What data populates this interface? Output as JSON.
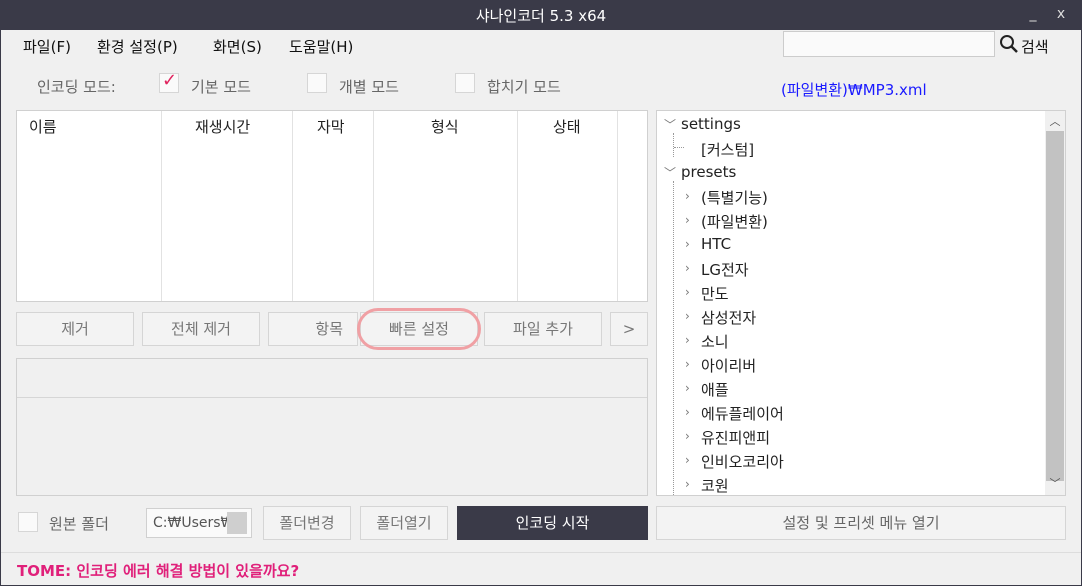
{
  "titlebar": {
    "title": "샤나인코더  5.3  x64",
    "minimize": "_",
    "close": "x"
  },
  "menu": {
    "items": [
      "파일(F)",
      "환경 설정(P)",
      "화면(S)",
      "도움말(H)"
    ],
    "search_value": "",
    "search_label": "검색"
  },
  "encoding_mode": {
    "label": "인코딩 모드:",
    "options": [
      {
        "label": "기본 모드",
        "checked": true
      },
      {
        "label": "개별 모드",
        "checked": false
      },
      {
        "label": "합치기 모드",
        "checked": false
      }
    ],
    "preset_path": "(파일변환)₩MP3.xml",
    "accent_color": "#1a1aff"
  },
  "file_table": {
    "columns": [
      "이름",
      "재생시간",
      "자막",
      "형식",
      "상태"
    ]
  },
  "buttons": {
    "remove": "제거",
    "remove_all": "전체 제거",
    "items": "항목",
    "quick_settings": "빠른 설정",
    "add_file": "파일 추가",
    "more": ">"
  },
  "tree": {
    "nodes": [
      {
        "label": "settings",
        "icon": "chevron-down-icon"
      },
      {
        "label": "[커스텀]"
      },
      {
        "label": "presets",
        "icon": "chevron-down-icon"
      },
      {
        "label": "(특별기능)",
        "icon": "chevron-right-icon"
      },
      {
        "label": "(파일변환)",
        "icon": "chevron-right-icon"
      },
      {
        "label": "HTC",
        "icon": "chevron-right-icon"
      },
      {
        "label": "LG전자",
        "icon": "chevron-right-icon"
      },
      {
        "label": "만도",
        "icon": "chevron-right-icon"
      },
      {
        "label": "삼성전자",
        "icon": "chevron-right-icon"
      },
      {
        "label": "소니",
        "icon": "chevron-right-icon"
      },
      {
        "label": "아이리버",
        "icon": "chevron-right-icon"
      },
      {
        "label": "애플",
        "icon": "chevron-right-icon"
      },
      {
        "label": "에듀플레이어",
        "icon": "chevron-right-icon"
      },
      {
        "label": "유진피앤피",
        "icon": "chevron-right-icon"
      },
      {
        "label": "인비오코리아",
        "icon": "chevron-right-icon"
      },
      {
        "label": "코원",
        "icon": "chevron-right-icon"
      }
    ]
  },
  "bottom": {
    "source_folder_label": "원본 폴더",
    "source_folder_checked": false,
    "output_path": "C:₩Users₩",
    "change_folder": "폴더변경",
    "open_folder": "폴더열기",
    "start_encoding": "인코딩 시작",
    "open_settings_menu": "설정 및 프리셋 메뉴 열기"
  },
  "status": {
    "tip": "TOME: 인코딩 에러 해결 방법이 있을까요?",
    "tip_color": "#e0207a"
  }
}
